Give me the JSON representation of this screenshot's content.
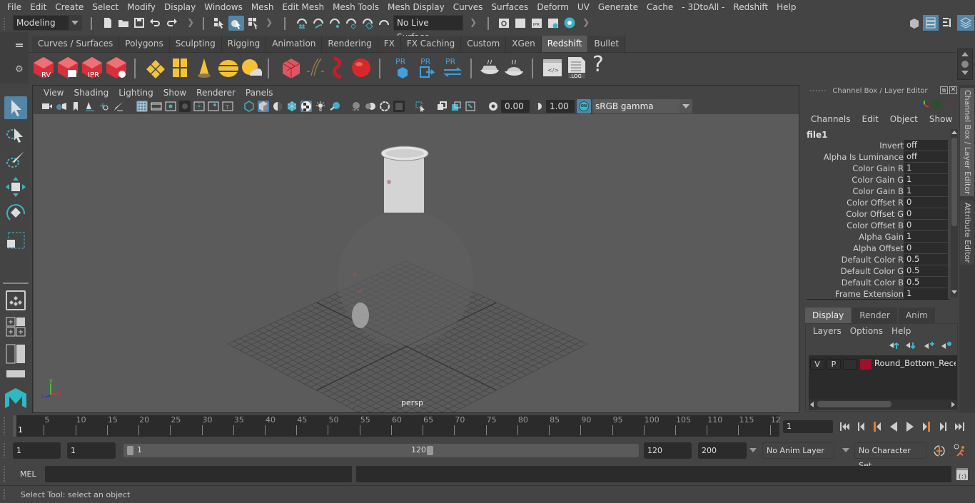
{
  "menubar": {
    "items": [
      "File",
      "Edit",
      "Create",
      "Select",
      "Modify",
      "Display",
      "Windows",
      "Mesh",
      "Edit Mesh",
      "Mesh Tools",
      "Mesh Display",
      "Curves",
      "Surfaces",
      "Deform",
      "UV",
      "Generate",
      "Cache",
      "- 3DtoAll -",
      "Redshift",
      "Help"
    ]
  },
  "statusline": {
    "menuset": "Modeling",
    "live_surface": "No Live Surface",
    "icons": [
      "new-scene-icon",
      "open-scene-icon",
      "save-scene-icon",
      "undo-icon",
      "redo-icon",
      "select-hierarchy-icon",
      "select-object-icon",
      "select-component-icon",
      "snap-grid-icon",
      "snap-curve-icon",
      "snap-point-icon",
      "snap-view-plane-icon",
      "snap-live-icon",
      "make-live-icon",
      "render-view-icon",
      "render-frame-icon",
      "ipr-render-icon",
      "render-settings-icon",
      "hypershade-icon"
    ]
  },
  "shelf": {
    "tabs": [
      "Curves / Surfaces",
      "Polygons",
      "Sculpting",
      "Rigging",
      "Animation",
      "Rendering",
      "FX",
      "FX Caching",
      "Custom",
      "XGen",
      "Redshift",
      "Bullet"
    ],
    "active_tab": "Redshift",
    "button_labels": {
      "rv": "RV",
      "ipr": "IPR",
      "pr": "PR",
      "log": ".LOG",
      "help": "?"
    }
  },
  "viewport": {
    "menu": [
      "View",
      "Shading",
      "Lighting",
      "Show",
      "Renderer",
      "Panels"
    ],
    "exposure": "0.00",
    "gamma": "1.00",
    "color_mgmt_toggle": "ON",
    "color_space": "sRGB gamma",
    "camera_label": "persp",
    "axis_labels": {
      "x": "x",
      "y": "y",
      "z": "z"
    }
  },
  "channelbox": {
    "title": "Channel Box / Layer Editor",
    "menu": [
      "Channels",
      "Edit",
      "Object",
      "Show"
    ],
    "node": "file1",
    "attributes": [
      {
        "name": "Invert",
        "value": "off"
      },
      {
        "name": "Alpha Is Luminance",
        "value": "off"
      },
      {
        "name": "Color Gain R",
        "value": "1"
      },
      {
        "name": "Color Gain G",
        "value": "1"
      },
      {
        "name": "Color Gain B",
        "value": "1"
      },
      {
        "name": "Color Offset R",
        "value": "0"
      },
      {
        "name": "Color Offset G",
        "value": "0"
      },
      {
        "name": "Color Offset B",
        "value": "0"
      },
      {
        "name": "Alpha Gain",
        "value": "1"
      },
      {
        "name": "Alpha Offset",
        "value": "0"
      },
      {
        "name": "Default Color R",
        "value": "0.5"
      },
      {
        "name": "Default Color G",
        "value": "0.5"
      },
      {
        "name": "Default Color B",
        "value": "0.5"
      },
      {
        "name": "Frame Extension",
        "value": "1"
      }
    ]
  },
  "side_tabs": [
    "Channel Box / Layer Editor",
    "Attribute Editor"
  ],
  "layer_editor": {
    "tabs": [
      "Display",
      "Render",
      "Anim"
    ],
    "active_tab": "Display",
    "menu": [
      "Layers",
      "Options",
      "Help"
    ],
    "layers": [
      {
        "visible": "V",
        "playback": "P",
        "name": "Round_Bottom_Receiv",
        "color": "#a0102a"
      }
    ]
  },
  "timeline": {
    "tick_labels": [
      "5",
      "10",
      "15",
      "20",
      "25",
      "30",
      "35",
      "40",
      "45",
      "50",
      "55",
      "60",
      "65",
      "70",
      "75",
      "80",
      "85",
      "90",
      "95",
      "100",
      "105",
      "110",
      "115",
      "12"
    ],
    "current_marker": "1",
    "current_frame": "1"
  },
  "range": {
    "start_time": "1",
    "playback_start": "1",
    "slider_start": "1",
    "slider_end": "120",
    "playback_end": "120",
    "end_time": "200",
    "anim_layer": "No Anim Layer",
    "character_set": "No Character Set"
  },
  "command_line": {
    "language": "MEL"
  },
  "help_line": {
    "text": "Select Tool: select an object"
  },
  "colors": {
    "accent_blue": "#5285a6",
    "teal": "#3fb3c6",
    "redshift_red": "#d6303a",
    "orange": "#e07b39"
  }
}
